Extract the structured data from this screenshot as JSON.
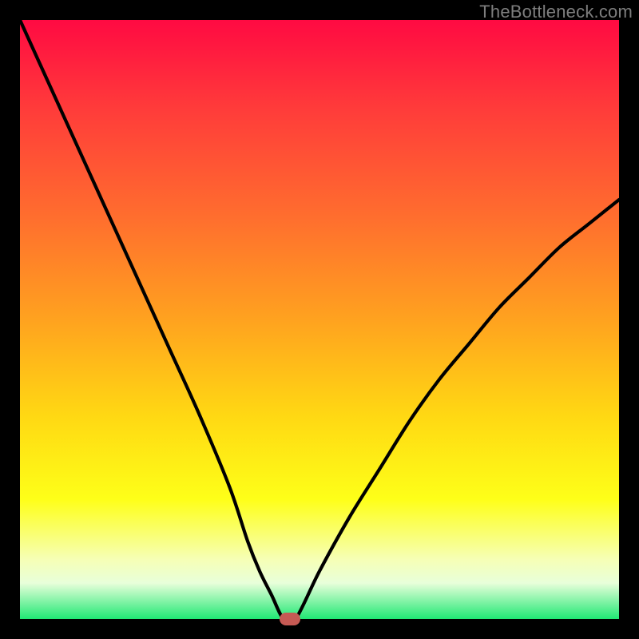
{
  "watermark": "TheBottleneck.com",
  "chart_data": {
    "type": "line",
    "title": "",
    "xlabel": "",
    "ylabel": "",
    "xlim": [
      0,
      100
    ],
    "ylim": [
      0,
      100
    ],
    "series": [
      {
        "name": "bottleneck-curve",
        "x": [
          0,
          5,
          10,
          15,
          20,
          25,
          30,
          35,
          38,
          40,
          42,
          44,
          46,
          50,
          55,
          60,
          65,
          70,
          75,
          80,
          85,
          90,
          95,
          100
        ],
        "values": [
          100,
          89,
          78,
          67,
          56,
          45,
          34,
          22,
          13,
          8,
          4,
          0,
          0,
          8,
          17,
          25,
          33,
          40,
          46,
          52,
          57,
          62,
          66,
          70
        ]
      }
    ],
    "marker": {
      "x": 45,
      "y": 0
    },
    "gradient_colors": {
      "top": "#ff0a42",
      "mid_orange": "#ffa21f",
      "yellow": "#feff18",
      "bottom_green": "#20e874"
    }
  }
}
